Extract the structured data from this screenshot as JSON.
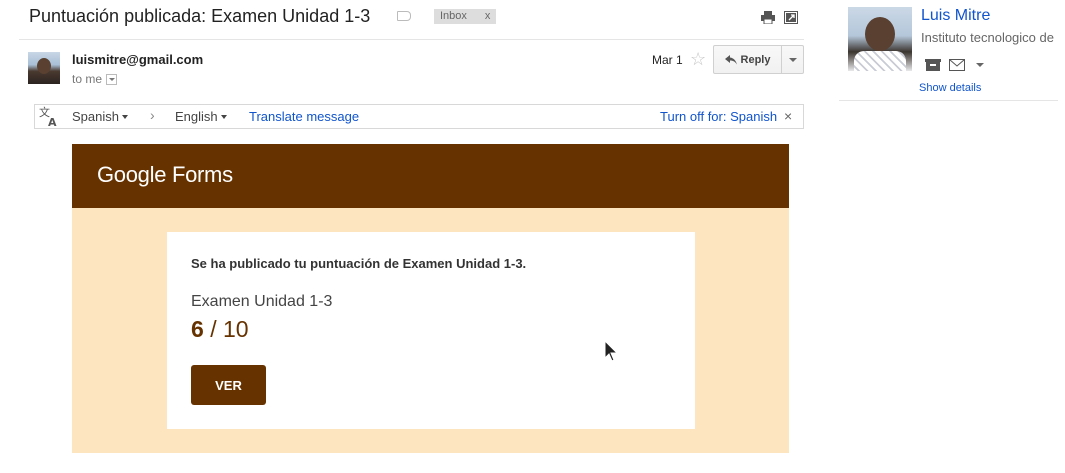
{
  "email": {
    "subject": "Puntuación publicada: Examen Unidad 1-3",
    "label_chip": "Inbox",
    "label_chip_close": "x",
    "sender_email": "luismitre@gmail.com",
    "recipient_text": "to me",
    "date": "Mar 1",
    "reply_label": "Reply"
  },
  "translate_bar": {
    "source_language": "Spanish",
    "target_language": "English",
    "translate_link": "Translate message",
    "turn_off_link": "Turn off for: Spanish",
    "close_glyph": "×"
  },
  "forms_email": {
    "logo_text": "Google Forms",
    "message": "Se ha publicado tu puntuación de Examen Unidad 1-3.",
    "quiz_title": "Examen Unidad 1-3",
    "score": "6",
    "score_separator": "/",
    "score_total": "10",
    "button_label": "VER"
  },
  "contact_card": {
    "name": "Luis Mitre",
    "organization": "Instituto tecnologico de",
    "show_details": "Show details"
  },
  "colors": {
    "forms_brown": "#663300",
    "forms_panel": "#fde5c0",
    "link_blue": "#1155cc"
  },
  "icons": [
    "label-tag-icon",
    "print-icon",
    "new-window-icon",
    "star-icon",
    "reply-arrow-icon",
    "translate-icon",
    "chevron-right-icon",
    "close-icon",
    "archive-icon",
    "mail-icon",
    "caret-down-icon",
    "mouse-cursor-icon"
  ]
}
